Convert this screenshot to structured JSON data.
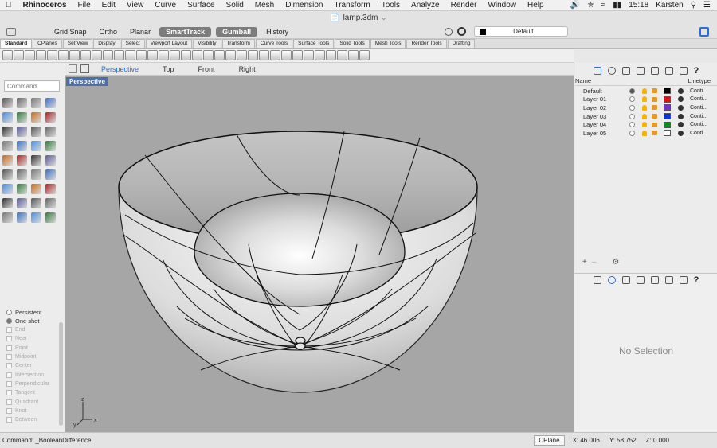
{
  "menubar": {
    "app": "Rhinoceros",
    "items": [
      "File",
      "Edit",
      "View",
      "Curve",
      "Surface",
      "Solid",
      "Mesh",
      "Dimension",
      "Transform",
      "Tools",
      "Analyze",
      "Render",
      "Window",
      "Help"
    ],
    "clock": "15:18",
    "user": "Karsten"
  },
  "window": {
    "title": "lamp.3dm"
  },
  "options": {
    "grid_snap": "Grid Snap",
    "ortho": "Ortho",
    "planar": "Planar",
    "smarttrack": "SmartTrack",
    "gumball": "Gumball",
    "history": "History",
    "current_layer": "Default"
  },
  "tabs": [
    "Standard",
    "CPlanes",
    "Set View",
    "Display",
    "Select",
    "Viewport Layout",
    "Visibility",
    "Transform",
    "Curve Tools",
    "Surface Tools",
    "Solid Tools",
    "Mesh Tools",
    "Render Tools",
    "Drafting"
  ],
  "command": {
    "placeholder": "Command"
  },
  "viewport": {
    "tabs": [
      "Perspective",
      "Top",
      "Front",
      "Right"
    ],
    "label": "Perspective",
    "axes": {
      "x": "x",
      "y": "y",
      "z": "z"
    }
  },
  "osnap": {
    "persistent": "Persistent",
    "one_shot": "One shot",
    "items": [
      "End",
      "Near",
      "Point",
      "Midpoint",
      "Center",
      "Intersection",
      "Perpendicular",
      "Tangent",
      "Quadrant",
      "Knot",
      "Between"
    ]
  },
  "layers": {
    "col_name": "Name",
    "col_linetype": "Linetype",
    "rows": [
      {
        "name": "Default",
        "color": "#000000",
        "current": true,
        "linetype": "Conti..."
      },
      {
        "name": "Layer 01",
        "color": "#e01010",
        "current": false,
        "linetype": "Conti..."
      },
      {
        "name": "Layer 02",
        "color": "#7a30c8",
        "current": false,
        "linetype": "Conti..."
      },
      {
        "name": "Layer 03",
        "color": "#1030d8",
        "current": false,
        "linetype": "Conti..."
      },
      {
        "name": "Layer 04",
        "color": "#108a20",
        "current": false,
        "linetype": "Conti..."
      },
      {
        "name": "Layer 05",
        "color": "#ffffff",
        "current": false,
        "linetype": "Conti..."
      }
    ]
  },
  "properties": {
    "empty": "No Selection"
  },
  "status": {
    "command": "Command: _BooleanDifference",
    "cplane": "CPlane",
    "x": "X: 46.006",
    "y": "Y: 58.752",
    "z": "Z: 0.000"
  }
}
